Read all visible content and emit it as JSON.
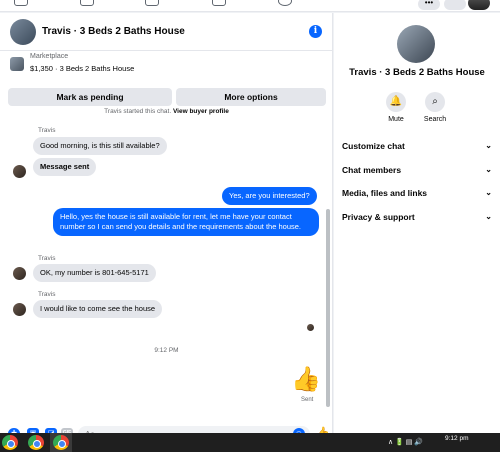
{
  "topbar": {
    "menu_glyph": "•••"
  },
  "chat": {
    "title": "Travis · 3 Beds 2 Baths House",
    "info_glyph": "i",
    "listing": {
      "category": "Marketplace",
      "summary": "$1,350 · 3 Beds 2 Baths House"
    },
    "actions": {
      "mark_pending": "Mark as pending",
      "more_options": "More options"
    },
    "system_note": {
      "text": "Travis started this chat.",
      "link": "View buyer profile"
    },
    "messages": [
      {
        "sender": "Travis",
        "text": "Good morning, is this still available?",
        "direction": "in"
      },
      {
        "sender": "",
        "text": "Message sent",
        "direction": "in"
      },
      {
        "sender": "",
        "text": "Yes, are you interested?",
        "direction": "out"
      },
      {
        "sender": "",
        "text": "Hello, yes the house is still available for rent, let me have your contact number so I can send you details and the requirements about the house.",
        "direction": "out"
      },
      {
        "sender": "Travis",
        "text": "OK, my number is 801-645-5171",
        "direction": "in"
      },
      {
        "sender": "Travis",
        "text": "I would like to come see the house",
        "direction": "in"
      }
    ],
    "timestamp": "9:12 PM",
    "like_glyph": "👍",
    "sent_label": "Sent",
    "composer": {
      "placeholder": "Aa",
      "plus_glyph": "+",
      "gif_label": "GIF",
      "emoji_glyph": "☺"
    },
    "colors": {
      "accent": "#0866ff",
      "bubble_in": "#e4e6eb"
    }
  },
  "side_panel": {
    "name": "Travis · 3 Beds 2 Baths House",
    "quick_actions": [
      {
        "label": "Mute",
        "icon": "bell-icon",
        "glyph": "🔔"
      },
      {
        "label": "Search",
        "icon": "search-icon",
        "glyph": "⌕"
      }
    ],
    "sections": [
      "Customize chat",
      "Chat members",
      "Media, files and links",
      "Privacy & support"
    ],
    "chevron": "⌄"
  },
  "taskbar": {
    "time": "9:12 pm",
    "tray": "∧  🔋  ▤  🔊"
  }
}
